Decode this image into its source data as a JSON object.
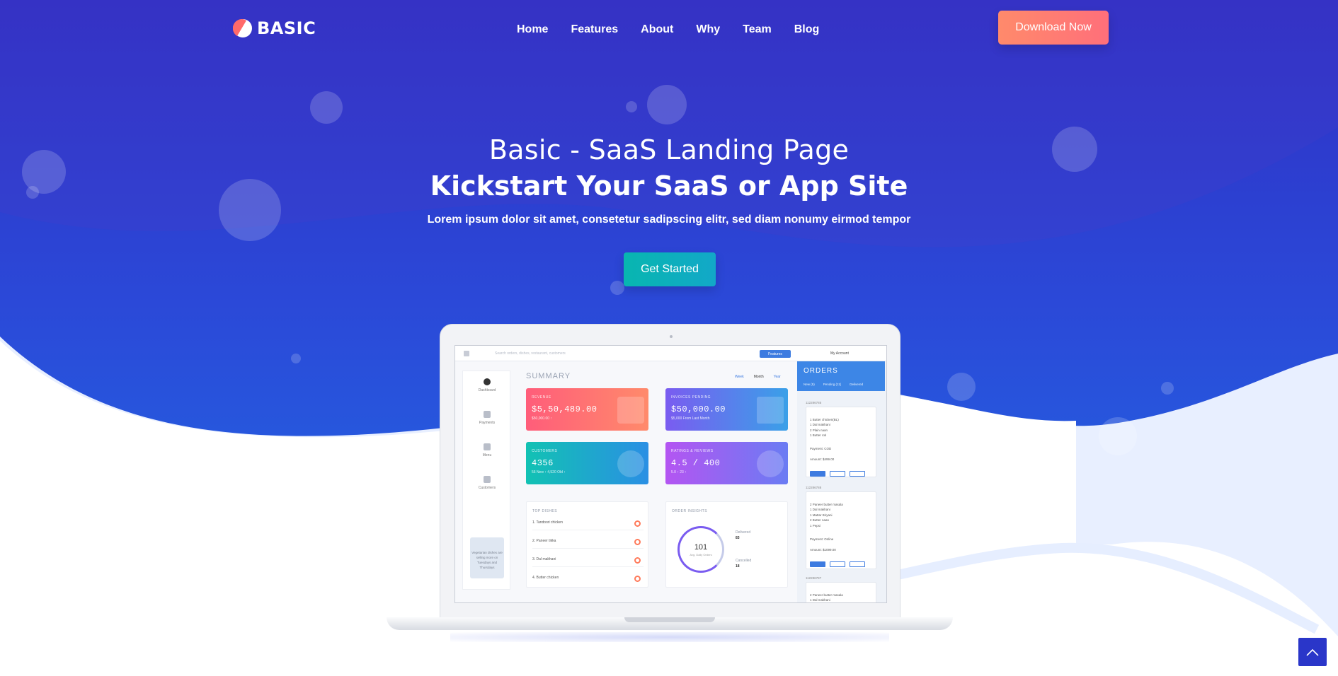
{
  "brand": {
    "name": "BASIC",
    "mark_color": "#ff6a6a"
  },
  "nav": {
    "items": [
      "Home",
      "Features",
      "About",
      "Why",
      "Team",
      "Blog"
    ],
    "cta": "Download Now"
  },
  "hero": {
    "title": "Basic - SaaS Landing Page",
    "subtitle": "Kickstart Your SaaS or App Site",
    "description": "Lorem ipsum dolor sit amet, consetetur sadipscing elitr, sed diam nonumy eirmod tempor",
    "cta": "Get Started"
  },
  "dashboard": {
    "search_placeholder": "Search orders, dishes, restaurant, customers",
    "features_label": "Features",
    "account_label": "My Account",
    "sidebar": [
      "Dashboard",
      "Payments",
      "Menu",
      "Customers"
    ],
    "sidebar_tip": "Vegetarian dishes are selling more on Tuesdays and Thursdays",
    "summary_title": "SUMMARY",
    "periods": [
      "Week",
      "Month",
      "Year"
    ],
    "cards": [
      {
        "label": "REVENUE",
        "value": "$5,50,489.00",
        "sub": "$50,000.00 ↑"
      },
      {
        "label": "INVOICES PENDING",
        "value": "$50,000.00",
        "sub": "$5,000 From Last Month"
      },
      {
        "label": "CUSTOMERS",
        "value": "4356",
        "sub": "56 New ↑     4,520 Old ↑"
      },
      {
        "label": "RATINGS & REVIEWS",
        "value": "4.5 / 400",
        "sub": "5.0 ↑      23 ↑"
      }
    ],
    "top_dishes_title": "TOP DISHES",
    "top_dishes": [
      "1. Tandoori chicken",
      "2. Paneer tikka",
      "3. Dal makhani",
      "4. Butter chicken"
    ],
    "insights_title": "ORDER INSIGHTS",
    "insights_total": "101",
    "insights_total_label": "Avg. Daily Orders",
    "delivered_label": "Delivered",
    "delivered_value": "83",
    "cancelled_label": "Cancelled",
    "cancelled_value": "18",
    "orders_title": "ORDERS",
    "orders_tabs": [
      "New (5)",
      "Pending (11)",
      "Delivered"
    ],
    "orders": [
      {
        "id": "112286785",
        "items": "1 Butter chicken(BL)\n1 Dal makhani\n2 Plain naan\n1 Butter roti",
        "payment": "Payment:  COD",
        "amount": "Amount:  $499.00"
      },
      {
        "id": "112286788",
        "items": "2 Paneer butter masala\n1 Dal makhani\n1 Mattar Biryani\n2 Butter naan\n1 Pepsi",
        "payment": "Payment:  Online",
        "amount": "Amount:  $1099.00"
      },
      {
        "id": "112286787",
        "items": "2 Paneer butter masala\n1 Dal makhani",
        "payment": "",
        "amount": ""
      }
    ]
  },
  "colors": {
    "hero_top": "#2f2fc4",
    "hero_bottom": "#1f6fe6",
    "cta_download": "#ff7a72",
    "cta_start": "#0db3b8",
    "to_top": "#2a36c9"
  }
}
